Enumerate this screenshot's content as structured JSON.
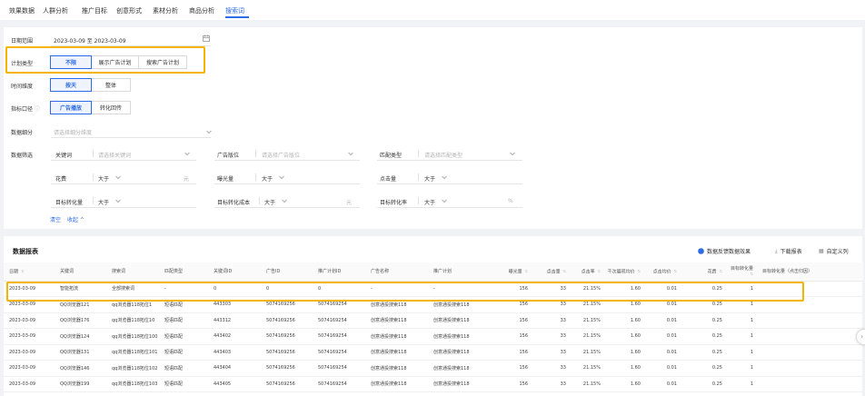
{
  "top_tabs": [
    "效果数据",
    "人群分析",
    "推广目标",
    "创意形式",
    "素材分析",
    "商品分析",
    "搜索词"
  ],
  "active_tab": "搜索词",
  "filters": {
    "date_label": "日期范围",
    "date_value": "2023-03-09 至 2023-03-09",
    "plan_type": {
      "label": "计划类型",
      "options": [
        "不限",
        "展示广告计划",
        "搜索广告计划"
      ],
      "selected": "不限"
    },
    "time_dim": {
      "label": "时间维度",
      "options": [
        "按天",
        "整体"
      ],
      "selected": "按天"
    },
    "metric_scope": {
      "label": "指标口径",
      "options": [
        "广告播放",
        "转化回传"
      ],
      "selected": "广告播放"
    },
    "data_detail": {
      "label": "数据细分",
      "placeholder": "请选择细分维度"
    },
    "data_filter_label": "数据筛选",
    "keyword": {
      "label": "关键词",
      "placeholder": "请选择关键词"
    },
    "ad_slot": {
      "label": "广告版位",
      "placeholder": "请选择广告版位"
    },
    "match_type": {
      "label": "匹配类型",
      "placeholder": "请选择匹配类型"
    },
    "spend": {
      "label": "花费",
      "op": "大于",
      "unit": "元"
    },
    "impressions": {
      "label": "曝光量",
      "op": "大于"
    },
    "clicks": {
      "label": "点击量",
      "op": "大于"
    },
    "target_conv": {
      "label": "目标转化量",
      "op": "大于"
    },
    "target_cost": {
      "label": "目标转化成本",
      "op": "大于",
      "unit": "元"
    },
    "target_rate": {
      "label": "目标转化率",
      "op": "大于",
      "unit": "%"
    },
    "clear": "清空",
    "collapse": "收起 ^"
  },
  "report": {
    "title": "数据报表",
    "tools": {
      "feedback": "数据反馈数据效果",
      "download": "下载报表",
      "custom_cols": "自定义列"
    },
    "columns": [
      "日期",
      "关键词",
      "搜索词",
      "匹配类型",
      "关键词ID",
      "广告ID",
      "推广计划ID",
      "广告名称",
      "推广计划",
      "曝光量",
      "点击量",
      "点击率",
      "千次展现均价",
      "点击均价",
      "花费",
      "目标转化量",
      "目标转化量（点击归因）"
    ],
    "rows": [
      [
        "2023-03-09",
        "智能拓流",
        "全部搜索词",
        "-",
        "0",
        "0",
        "0",
        "-",
        "-",
        "156",
        "33",
        "21.15%",
        "1.60",
        "0.01",
        "0.25",
        "1",
        ""
      ],
      [
        "2023-03-09",
        "QQ浏览器121",
        "qq浏览器118拓位1",
        "短语匹配",
        "443303",
        "5074169256",
        "5074169254",
        "创意通投搜索118",
        "创意通投搜索118",
        "156",
        "33",
        "21.15%",
        "1.60",
        "0.01",
        "0.25",
        "1",
        ""
      ],
      [
        "2023-03-09",
        "QQ浏览器176",
        "qq浏览器118拓位10",
        "短语匹配",
        "443312",
        "5074169256",
        "5074169254",
        "创意通投搜索118",
        "创意通投搜索118",
        "156",
        "33",
        "21.15%",
        "1.60",
        "0.01",
        "0.25",
        "1",
        ""
      ],
      [
        "2023-03-09",
        "QQ浏览器124",
        "qq浏览器118拓位100",
        "短语匹配",
        "443402",
        "5074169256",
        "5074169254",
        "创意通投搜索118",
        "创意通投搜索118",
        "156",
        "33",
        "21.15%",
        "1.60",
        "0.01",
        "0.25",
        "1",
        ""
      ],
      [
        "2023-03-09",
        "QQ浏览器131",
        "qq浏览器118拓位101",
        "短语匹配",
        "443403",
        "5074169256",
        "5074169254",
        "创意通投搜索118",
        "创意通投搜索118",
        "156",
        "33",
        "21.15%",
        "1.60",
        "0.01",
        "0.25",
        "1",
        ""
      ],
      [
        "2023-03-09",
        "QQ浏览器146",
        "qq浏览器118拓位102",
        "短语匹配",
        "443404",
        "5074169256",
        "5074169254",
        "创意通投搜索118",
        "创意通投搜索118",
        "156",
        "33",
        "21.15%",
        "1.60",
        "0.01",
        "0.25",
        "1",
        ""
      ],
      [
        "2023-03-09",
        "QQ浏览器199",
        "qq浏览器118拓位103",
        "短语匹配",
        "443405",
        "5074169256",
        "5074169254",
        "创意通投搜索118",
        "创意通投搜索118",
        "156",
        "33",
        "21.15%",
        "1.60",
        "0.01",
        "0.25",
        "1",
        ""
      ]
    ]
  },
  "colors": {
    "accent": "#2e6be6",
    "highlight": "#f5b400",
    "background": "#f0f2f5"
  }
}
